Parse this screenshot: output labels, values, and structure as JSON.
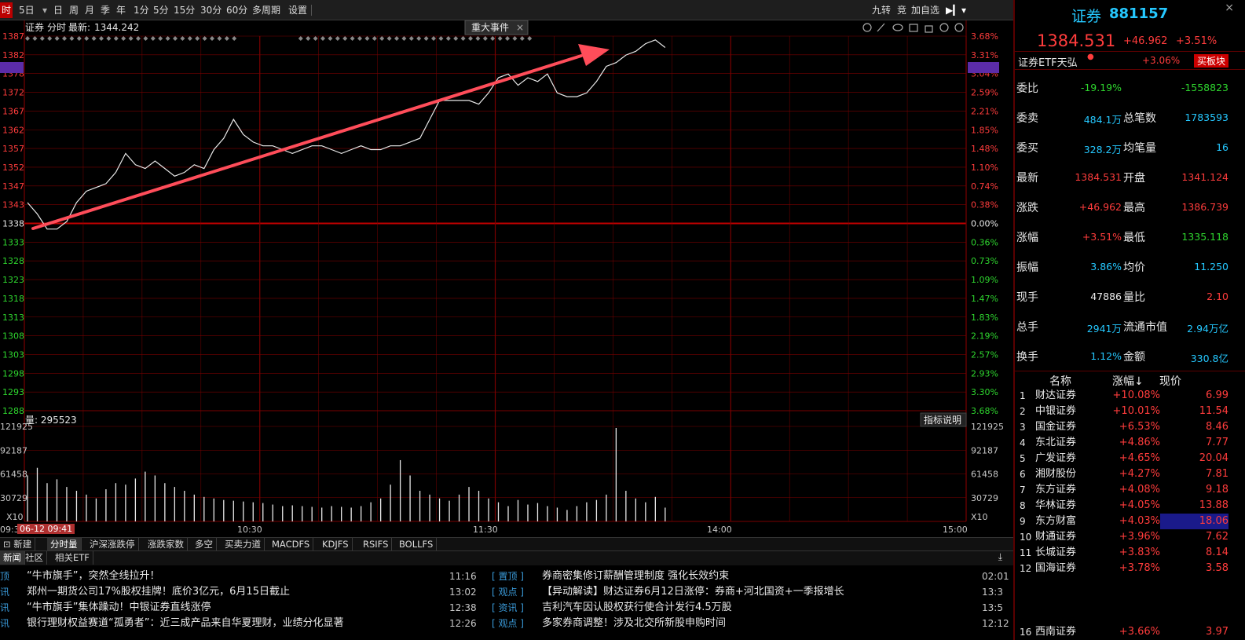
{
  "toolbar": {
    "buttons": [
      "时",
      "5日",
      "日",
      "周",
      "月",
      "季",
      "年",
      "1分",
      "5分",
      "15分",
      "30分",
      "60分",
      "多周期",
      "设置"
    ],
    "right_buttons": [
      "九转",
      "竞",
      "加自选"
    ]
  },
  "chart": {
    "info_title": "证券",
    "info_mode": "分时",
    "info_latest_label": "最新:",
    "info_latest": "1344.242",
    "event_tab": "重大事件",
    "event_close": "×",
    "price_ticks": [
      "1387",
      "1382",
      "1378",
      "1372",
      "1367",
      "1362",
      "1357",
      "1352",
      "1347",
      "1343",
      "1338",
      "1333",
      "1328",
      "1323",
      "1318",
      "1313",
      "1308",
      "1303",
      "1298",
      "1293",
      "1288"
    ],
    "pct_ticks": [
      "3.68%",
      "3.31%",
      "3.04%",
      "2.59%",
      "2.21%",
      "1.85%",
      "1.48%",
      "1.10%",
      "0.74%",
      "0.38%",
      "0.00%",
      "0.36%",
      "0.73%",
      "1.09%",
      "1.47%",
      "1.83%",
      "2.19%",
      "2.57%",
      "2.93%",
      "3.30%",
      "3.68%"
    ],
    "volume_label": "量: 295523",
    "indicator_help": "指标说明",
    "vol_ticks": [
      "121925",
      "92187",
      "61458",
      "30729"
    ],
    "vol_scale": "X10",
    "x_labels": [
      "09:30",
      "10:30",
      "11:30",
      "14:00",
      "15:00"
    ],
    "cursor_date": "06-12 09:41",
    "colors": {
      "grid": "#7a0000",
      "baseline": "#c00000",
      "price": "#e8e8e8",
      "arrow": "#ff4d5a",
      "axis_red": "#ff3c3c",
      "axis_green": "#2ed52e",
      "highlight": "#5b2ca8"
    }
  },
  "chart_data": {
    "type": "line",
    "title": "证券 分时",
    "x_range": [
      "09:30",
      "15:00"
    ],
    "ylim": [
      1288,
      1387
    ],
    "prev_close": 1338,
    "series": [
      {
        "name": "price",
        "values": [
          1343,
          1340,
          1336,
          1336,
          1338,
          1343,
          1346,
          1347,
          1348,
          1351,
          1356,
          1353,
          1352,
          1354,
          1352,
          1350,
          1351,
          1353,
          1352,
          1357,
          1360,
          1365,
          1361,
          1359,
          1358,
          1358,
          1357,
          1356,
          1357,
          1358,
          1358,
          1357,
          1356,
          1357,
          1358,
          1357,
          1357,
          1358,
          1358,
          1359,
          1360,
          1365,
          1370,
          1370,
          1370,
          1370,
          1369,
          1372,
          1376,
          1377,
          1374,
          1376,
          1375,
          1377,
          1372,
          1371,
          1371,
          1372,
          1375,
          1379,
          1380,
          1382,
          1383,
          1385,
          1386,
          1384
        ]
      },
      {
        "name": "volume",
        "values": [
          60000,
          70000,
          50000,
          55000,
          45000,
          40000,
          35000,
          30000,
          42000,
          50000,
          48000,
          56000,
          65000,
          60000,
          50000,
          45000,
          40000,
          35000,
          32000,
          30000,
          28000,
          27000,
          26000,
          25000,
          24000,
          22000,
          20000,
          21000,
          20000,
          19000,
          18000,
          20000,
          19000,
          18000,
          20000,
          25000,
          30000,
          48000,
          80000,
          60000,
          40000,
          35000,
          30000,
          27000,
          35000,
          45000,
          40000,
          30000,
          25000,
          20000,
          28000,
          22000,
          24000,
          20000,
          18000,
          15000,
          20000,
          25000,
          28000,
          35000,
          122000,
          40000,
          30000,
          25000,
          32000,
          18000
        ]
      }
    ]
  },
  "news_left": [
    {
      "tag": "顶",
      "title": "“牛市旗手”，突然全线拉升！",
      "time": "11:16"
    },
    {
      "tag": "讯",
      "title": "郑州一期货公司17%股权挂牌！底价3亿元，6月15日截止",
      "time": "13:02"
    },
    {
      "tag": "讯",
      "title": "“牛市旗手”集体躁动！中银证券直线涨停",
      "time": "12:38"
    },
    {
      "tag": "讯",
      "title": "银行理财权益赛道“孤勇者”：近三成产品来自华夏理财，业绩分化显著",
      "time": "12:26"
    }
  ],
  "news_right": [
    {
      "tag": "[ 置顶 ]",
      "title": "券商密集修订薪酬管理制度 强化长效约束",
      "time": "02:01"
    },
    {
      "tag": "[ 观点 ]",
      "title": "【异动解读】财达证券6月12日涨停：券商+河北国资+一季报增长",
      "time": "13:3"
    },
    {
      "tag": "[ 资讯 ]",
      "title": "吉利汽车因认股权获行使合计发行4.5万股",
      "time": "13:5"
    },
    {
      "tag": "[ 观点 ]",
      "title": "多家券商调整！涉及北交所新股申购时间",
      "time": "12:12"
    }
  ],
  "tabs_row1": [
    "新建",
    "分时量",
    "沪深涨跌停",
    "涨跌家数",
    "多空",
    "买卖力道",
    "MACDFS",
    "KDJFS",
    "RSIFS",
    "BOLLFS"
  ],
  "tabs_row2": [
    "新闻",
    "社区",
    "相关ETF"
  ],
  "quote": {
    "name": "证券",
    "code": "881157",
    "price": "1384.531",
    "change": "+46.962",
    "change_pct": "+3.51%",
    "etf_name": "证券ETF天弘",
    "etf_pct": "+3.06%",
    "etf_btn": "买板块",
    "rows": [
      {
        "l1": "委比",
        "v1": "-19.19%",
        "c1": "green",
        "l2": "",
        "v2": "-1558823",
        "c2": "green"
      },
      {
        "l1": "委卖",
        "v1": "484.1万",
        "c1": "cyan",
        "l2": "总笔数",
        "v2": "1783593",
        "c2": "cyan"
      },
      {
        "l1": "委买",
        "v1": "328.2万",
        "c1": "cyan",
        "l2": "均笔量",
        "v2": "16",
        "c2": "cyan"
      },
      {
        "l1": "最新",
        "v1": "1384.531",
        "c1": "red",
        "l2": "开盘",
        "v2": "1341.124",
        "c2": "red"
      },
      {
        "l1": "涨跌",
        "v1": "+46.962",
        "c1": "red",
        "l2": "最高",
        "v2": "1386.739",
        "c2": "red"
      },
      {
        "l1": "涨幅",
        "v1": "+3.51%",
        "c1": "red",
        "l2": "最低",
        "v2": "1335.118",
        "c2": "green"
      },
      {
        "l1": "振幅",
        "v1": "3.86%",
        "c1": "cyan",
        "l2": "均价",
        "v2": "11.250",
        "c2": "cyan"
      },
      {
        "l1": "现手",
        "v1": "47886",
        "c1": "white",
        "l2": "量比",
        "v2": "2.10",
        "c2": "red"
      },
      {
        "l1": "总手",
        "v1": "2941万",
        "c1": "cyan",
        "l2": "流通市值",
        "v2": "2.94万亿",
        "c2": "cyan"
      },
      {
        "l1": "换手",
        "v1": "1.12%",
        "c1": "cyan",
        "l2": "金额",
        "v2": "330.8亿",
        "c2": "cyan"
      }
    ],
    "rank_headers": [
      "名称",
      "涨幅↓",
      "现价"
    ],
    "rank": [
      {
        "no": "1",
        "name": "财达证券",
        "pct": "+10.08%",
        "price": "6.99"
      },
      {
        "no": "2",
        "name": "中银证券",
        "pct": "+10.01%",
        "price": "11.54"
      },
      {
        "no": "3",
        "name": "国金证券",
        "pct": "+6.53%",
        "price": "8.46"
      },
      {
        "no": "4",
        "name": "东北证券",
        "pct": "+4.86%",
        "price": "7.77"
      },
      {
        "no": "5",
        "name": "广发证券",
        "pct": "+4.65%",
        "price": "20.04"
      },
      {
        "no": "6",
        "name": "湘财股份",
        "pct": "+4.27%",
        "price": "7.81"
      },
      {
        "no": "7",
        "name": "东方证券",
        "pct": "+4.08%",
        "price": "9.18"
      },
      {
        "no": "8",
        "name": "华林证券",
        "pct": "+4.05%",
        "price": "13.88"
      },
      {
        "no": "9",
        "name": "东方财富",
        "pct": "+4.03%",
        "price": "18.06"
      },
      {
        "no": "10",
        "name": "财通证券",
        "pct": "+3.96%",
        "price": "7.62"
      },
      {
        "no": "11",
        "name": "长城证券",
        "pct": "+3.83%",
        "price": "8.14"
      },
      {
        "no": "12",
        "name": "国海证券",
        "pct": "+3.78%",
        "price": "3.58"
      },
      {
        "no": "16",
        "name": "西南证券",
        "pct": "+3.66%",
        "price": "3.97"
      }
    ]
  }
}
